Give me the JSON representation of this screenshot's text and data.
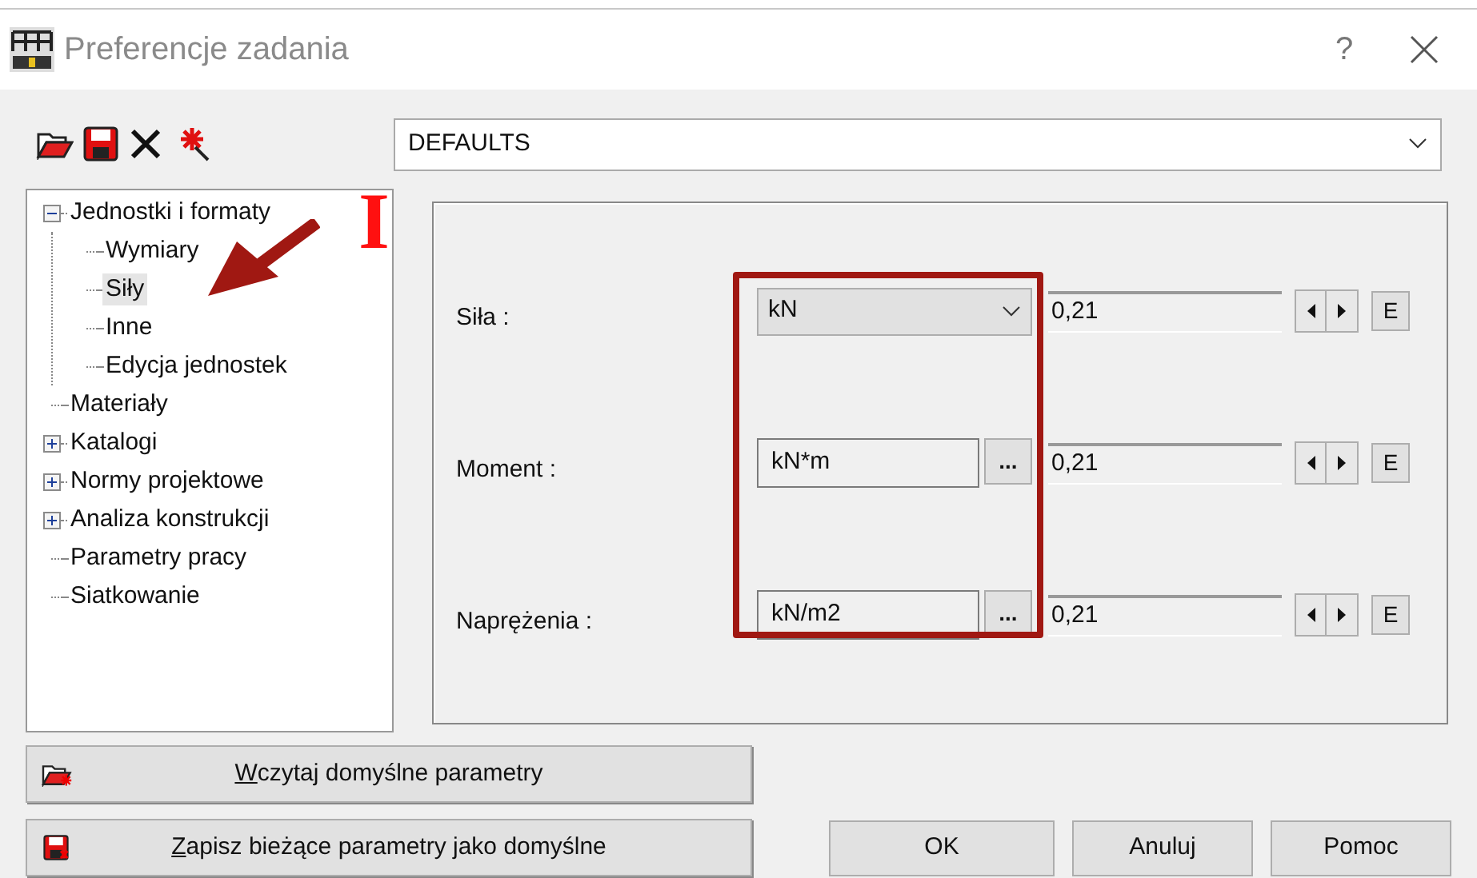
{
  "window": {
    "title": "Preferencje zadania",
    "help": "?"
  },
  "profile": {
    "value": "DEFAULTS"
  },
  "tree": [
    {
      "label": "Jednostki i formaty",
      "expanded": true,
      "selected": false,
      "children": [
        {
          "label": "Wymiary",
          "selected": false
        },
        {
          "label": "Siły",
          "selected": true
        },
        {
          "label": "Inne",
          "selected": false
        },
        {
          "label": "Edycja jednostek",
          "selected": false
        }
      ]
    },
    {
      "label": "Materiały",
      "selected": false
    },
    {
      "label": "Katalogi",
      "expanded": false,
      "selected": false
    },
    {
      "label": "Normy projektowe",
      "expanded": false,
      "selected": false
    },
    {
      "label": "Analiza konstrukcji",
      "expanded": false,
      "selected": false
    },
    {
      "label": "Parametry pracy",
      "selected": false
    },
    {
      "label": "Siatkowanie",
      "selected": false
    }
  ],
  "units": [
    {
      "label": "Siła :",
      "kind": "dropdown",
      "unit": "kN",
      "precision": "0,21",
      "edit": "E"
    },
    {
      "label": "Moment :",
      "kind": "picker",
      "unit": "kN*m",
      "more": "...",
      "precision": "0,21",
      "edit": "E"
    },
    {
      "label": "Naprężenia :",
      "kind": "picker",
      "unit": "kN/m2",
      "more": "...",
      "precision": "0,21",
      "edit": "E"
    }
  ],
  "default_buttons": [
    {
      "label": "Wczytaj domyślne parametry",
      "accelerator_first": true
    },
    {
      "label": "Zapisz bieżące parametry jako domyślne",
      "accelerator_first": true
    }
  ],
  "buttons": [
    "OK",
    "Anuluj",
    "Pomoc"
  ],
  "annotation": {
    "marker": "I"
  }
}
